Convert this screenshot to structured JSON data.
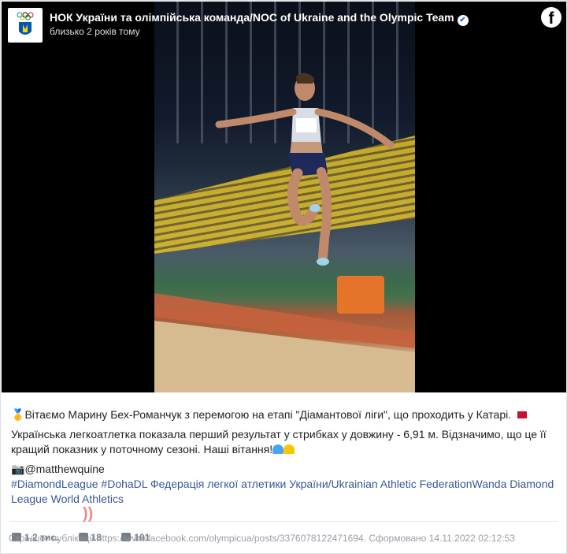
{
  "page": {
    "name": "НОК України та олімпійська команда/NOC of Ukraine and the Olympic Team",
    "verified_glyph": "✔",
    "time": "близько 2 років тому",
    "fb_glyph": "f"
  },
  "post": {
    "line1_icon": "🥇",
    "line1": "Вітаємо Марину Бех-Романчук з перемогою на етапі \"Діамантової ліги\", що проходить у Катарі.",
    "line2": "Українська легкоатлетка показала перший результат у стрибках у довжину - 6,91 м. Відзначимо, що це її кращий показник у поточному сезоні. Наші вітання!",
    "line3_icon": "📷",
    "line3": "@matthewquine",
    "tags": "#DiamondLeague #DohaDL Федерація легкої атлетики України/Ukrainian Athletic FederationWanda Diamond League World Athletics"
  },
  "stats": {
    "likes": "1,2 тис.",
    "comments": "18",
    "shares": "101"
  },
  "footer": {
    "caption": "Скріншот публікації https://www.facebook.com/olympicua/posts/3376078122471694. Сформовано 14.11.2022 02:12:53"
  },
  "colors": {
    "link": "#385898",
    "heart_blue": "#4aa3f0",
    "heart_yellow": "#f7c600"
  },
  "icons": [
    "olympic-logo-icon",
    "verified-icon",
    "facebook-icon",
    "medal-icon",
    "flag-icon",
    "camera-icon",
    "like-icon",
    "comment-icon",
    "share-icon"
  ]
}
